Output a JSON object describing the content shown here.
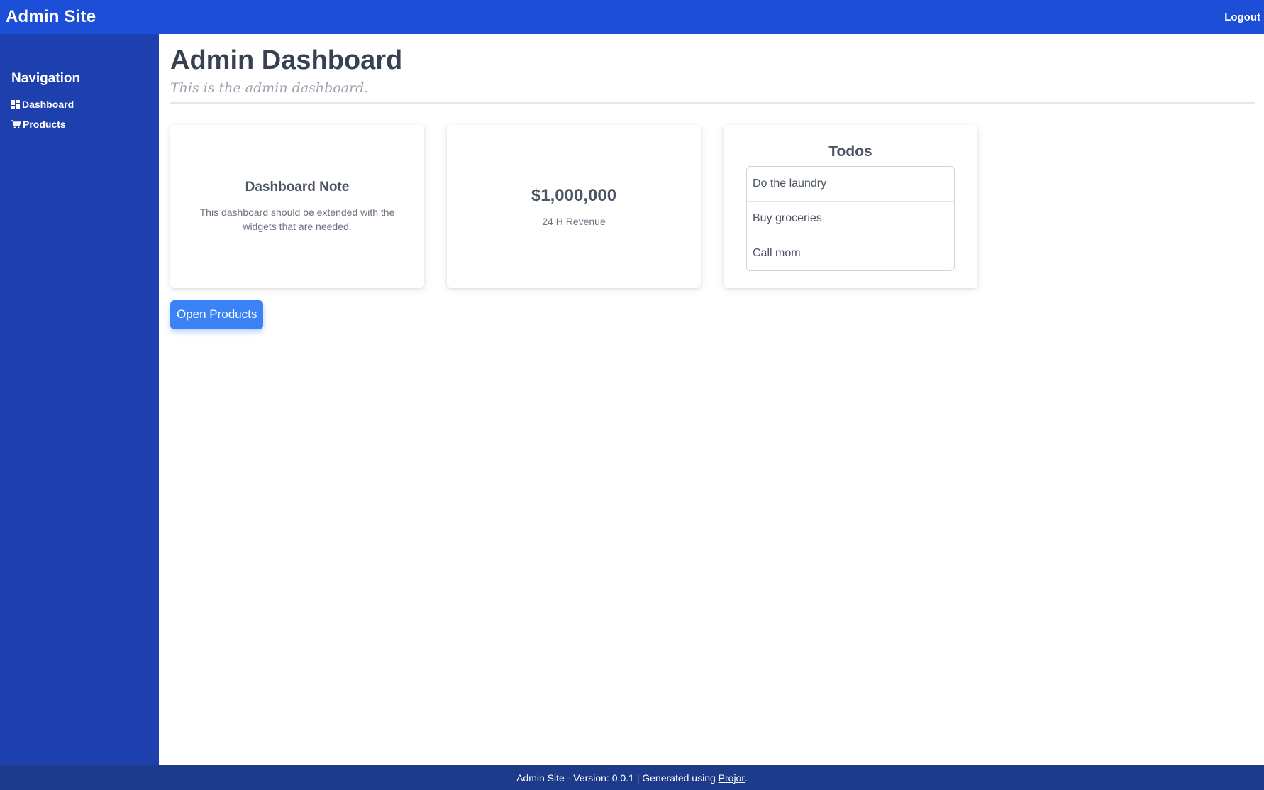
{
  "header": {
    "brand": "Admin Site",
    "logout_label": "Logout"
  },
  "sidebar": {
    "heading": "Navigation",
    "items": [
      {
        "label": "Dashboard",
        "icon": "dashboard-grid-icon"
      },
      {
        "label": "Products",
        "icon": "cart-icon"
      }
    ]
  },
  "main": {
    "title": "Admin Dashboard",
    "subtitle": "This is the admin dashboard.",
    "cards": {
      "note": {
        "title": "Dashboard Note",
        "text": "This dashboard should be extended with the widgets that are needed."
      },
      "revenue": {
        "value": "$1,000,000",
        "label": "24 H Revenue"
      },
      "todos": {
        "title": "Todos",
        "items": [
          "Do the laundry",
          "Buy groceries",
          "Call mom"
        ]
      }
    },
    "open_products_label": "Open Products"
  },
  "footer": {
    "prefix": "Admin Site - Version: 0.0.1 | Generated using",
    "link_label": "Projor",
    "suffix": "."
  },
  "colors": {
    "topbar": "#1d4ed8",
    "sidebar": "#1e40af",
    "footer": "#1e3a8a",
    "primary_button": "#3b82f6"
  }
}
